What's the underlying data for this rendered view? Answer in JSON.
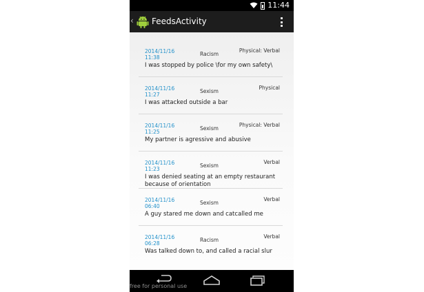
{
  "status_bar": {
    "time": "11:44"
  },
  "action_bar": {
    "title": "FeedsActivity"
  },
  "feeds": [
    {
      "date": "2014/11/16 11:38",
      "type": "Racism",
      "form": "Physical: Verbal",
      "description": "I was stopped by police \\for my own safety\\"
    },
    {
      "date": "2014/11/16 11:27",
      "type": "Sexism",
      "form": "Physical",
      "description": "I was attacked outside a bar"
    },
    {
      "date": "2014/11/16 11:25",
      "type": "Sexism",
      "form": "Physical: Verbal",
      "description": "My partner is agressive and abusive"
    },
    {
      "date": "2014/11/16 11:23",
      "type": "Sexism",
      "form": "Verbal",
      "description": "I was denied seating at an empty restaurant because of orientation"
    },
    {
      "date": "2014/11/16 06:40",
      "type": "Sexism",
      "form": "Verbal",
      "description": "A guy stared me down and catcalled me"
    },
    {
      "date": "2014/11/16 06:28",
      "type": "Racism",
      "form": "Verbal",
      "description": "Was talked down to, and called a racial slur"
    }
  ],
  "watermark": "free for personal use",
  "icons": {
    "wifi": "wifi-icon",
    "battery": "battery-icon",
    "app": "android-icon",
    "overflow": "overflow-menu-icon",
    "back": "back-icon",
    "home": "home-icon",
    "recents": "recents-icon"
  }
}
